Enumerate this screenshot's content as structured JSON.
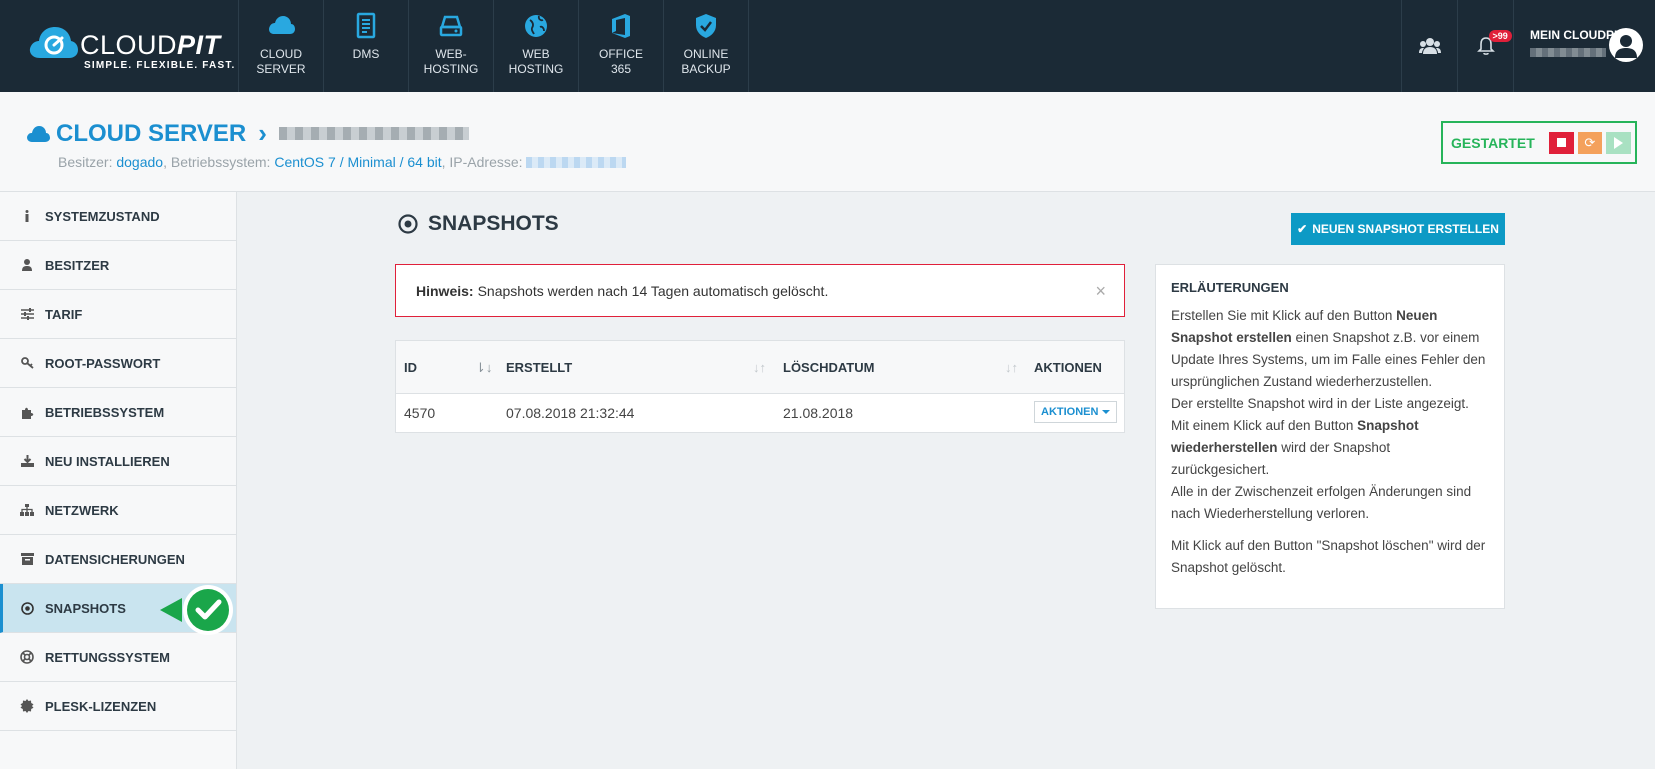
{
  "brand": {
    "name_light": "CLOUD",
    "name_bold": "PIT",
    "tagline": "SIMPLE. FLEXIBLE. FAST."
  },
  "topnav": [
    {
      "label": "CLOUD\nSERVER",
      "icon": "cloud-icon"
    },
    {
      "label": "DMS",
      "icon": "document-icon"
    },
    {
      "label": "WEB-\nHOSTING",
      "icon": "server-drive-icon"
    },
    {
      "label": "WEB\nHOSTING",
      "icon": "globe-icon"
    },
    {
      "label": "OFFICE\n365",
      "icon": "office-icon"
    },
    {
      "label": "ONLINE\nBACKUP",
      "icon": "shield-icon"
    }
  ],
  "topbar_right": {
    "notification_badge": ">99",
    "account_title": "MEIN CLOUDPIT"
  },
  "page": {
    "title": "CLOUD SERVER",
    "owner_label": "Besitzer:",
    "owner_value": "dogado",
    "os_label": ", Betriebssystem:",
    "os_value": "CentOS 7 / Minimal / 64 bit",
    "ip_label": ", IP-Adresse:"
  },
  "server_status": {
    "label": "GESTARTET",
    "colors": {
      "stop": "#e0203a",
      "restart": "#f4a15c",
      "start": "#a9e1c2",
      "ok": "#26b45a"
    }
  },
  "sidebar": {
    "items": [
      {
        "label": "SYSTEMZUSTAND",
        "icon": "info-icon"
      },
      {
        "label": "BESITZER",
        "icon": "user-icon"
      },
      {
        "label": "TARIF",
        "icon": "sliders-icon"
      },
      {
        "label": "ROOT-PASSWORT",
        "icon": "key-icon"
      },
      {
        "label": "BETRIEBSSYSTEM",
        "icon": "puzzle-icon"
      },
      {
        "label": "NEU INSTALLIEREN",
        "icon": "download-icon"
      },
      {
        "label": "NETZWERK",
        "icon": "sitemap-icon"
      },
      {
        "label": "DATENSICHERUNGEN",
        "icon": "archive-icon"
      },
      {
        "label": "SNAPSHOTS",
        "icon": "dot-circle-icon",
        "active": true
      },
      {
        "label": "RETTUNGSSYSTEM",
        "icon": "life-ring-icon"
      },
      {
        "label": "PLESK-LIZENZEN",
        "icon": "certificate-icon"
      }
    ]
  },
  "main": {
    "title": "SNAPSHOTS",
    "new_button": "NEUEN SNAPSHOT ERSTELLEN",
    "alert": {
      "label": "Hinweis:",
      "text": "Snapshots werden nach 14 Tagen automatisch gelöscht.",
      "close": "×"
    },
    "table": {
      "columns": [
        "ID",
        "ERSTELLT",
        "LÖSCHDATUM",
        "AKTIONEN"
      ],
      "rows": [
        {
          "id": "4570",
          "created": "07.08.2018 21:32:44",
          "delete_date": "21.08.2018",
          "action": "AKTIONEN"
        }
      ]
    }
  },
  "info": {
    "title": "ERLÄUTERUNGEN",
    "p1_a": "Erstellen Sie mit Klick auf den Button ",
    "p1_b": "Neuen Snapshot erstellen",
    "p1_c": " einen Snapshot z.B. vor einem Update Ihres Systems, um im Falle eines Fehler den ursprünglichen Zustand wiederherzustellen.",
    "p1_d": "Der erstellte Snapshot wird in der Liste angezeigt.",
    "p1_e": "Mit einem Klick auf den Button ",
    "p1_f": "Snapshot wiederherstellen",
    "p1_g": " wird der Snapshot zurückgesichert.",
    "p1_h": "Alle in der Zwischenzeit erfolgen Änderungen sind nach Wiederherstellung verloren.",
    "p2": "Mit Klick auf den Button \"Snapshot löschen\" wird der Snapshot gelöscht."
  }
}
